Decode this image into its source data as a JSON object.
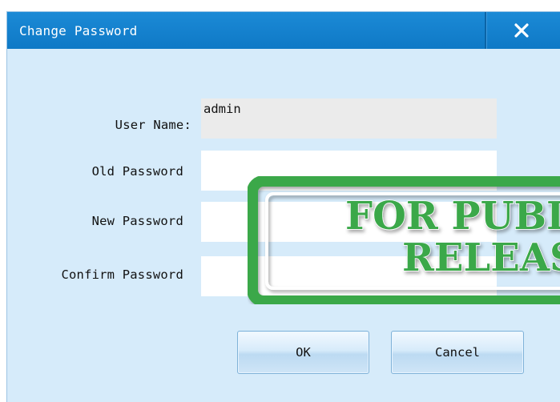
{
  "dialog": {
    "title": "Change Password",
    "close_icon": "close-icon"
  },
  "form": {
    "username_label": "User Name:",
    "username_value": "admin",
    "old_password_label": "Old Password",
    "old_password_value": "",
    "new_password_label": "New Password",
    "new_password_value": "",
    "confirm_password_label": "Confirm Password",
    "confirm_password_value": ""
  },
  "buttons": {
    "ok_label": "OK",
    "cancel_label": "Cancel"
  },
  "watermark": {
    "line1": "FOR PUBLIC",
    "line2": "RELEASE"
  },
  "colors": {
    "titlebar": "#1482cf",
    "dialog_bg": "#d6ebfa",
    "stamp_green": "#3aa84a"
  }
}
